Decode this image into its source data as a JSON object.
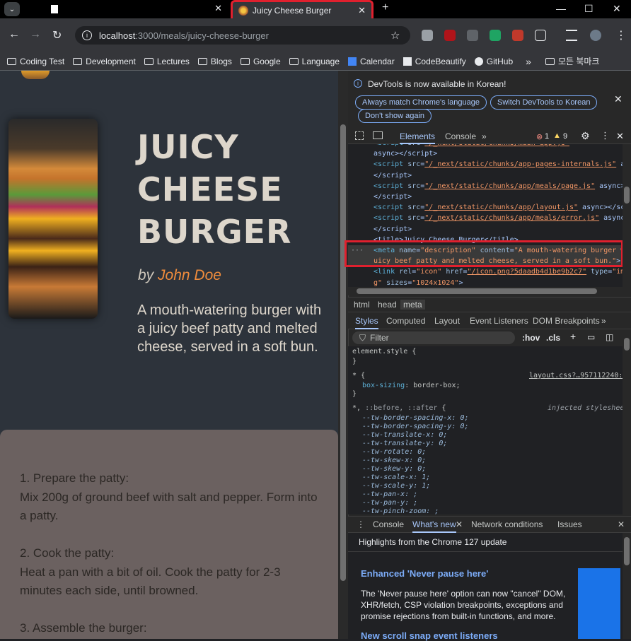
{
  "tabs": [
    {
      "label": "",
      "active": false
    },
    {
      "label": "Juicy Cheese Burger",
      "active": true
    }
  ],
  "address": {
    "host": "localhost",
    "path": ":3000/meals/juicy-cheese-burger"
  },
  "bookmarks": [
    {
      "label": "Coding Test",
      "icon": "folder-icon"
    },
    {
      "label": "Development",
      "icon": "folder-icon"
    },
    {
      "label": "Lectures",
      "icon": "folder-icon"
    },
    {
      "label": "Blogs",
      "icon": "folder-icon"
    },
    {
      "label": "Google",
      "icon": "folder-icon"
    },
    {
      "label": "Language",
      "icon": "folder-icon"
    },
    {
      "label": "Calendar",
      "icon": "calendar-icon"
    },
    {
      "label": "CodeBeautify",
      "icon": "codebeautify-icon"
    },
    {
      "label": "GitHub",
      "icon": "github-icon"
    }
  ],
  "bookmarks_overflow": "»",
  "bookmarks_all": "모든 북마크",
  "meal": {
    "title": "Juicy Cheese Burger",
    "by": "by",
    "author": "John Doe",
    "summary": "A mouth-watering burger with a juicy beef patty and melted cheese, served in a soft bun.",
    "instructions": [
      {
        "step": "1. Prepare the patty:",
        "text": "Mix 200g of ground beef with salt and pepper. Form into a patty."
      },
      {
        "step": "2. Cook the patty:",
        "text": "Heat a pan with a bit of oil. Cook the patty for 2-3 minutes each side, until browned."
      },
      {
        "step": "3. Assemble the burger:",
        "text": ""
      }
    ]
  },
  "devtools": {
    "notice": "DevTools is now available in Korean!",
    "btn_match": "Always match Chrome's language",
    "btn_switch": "Switch DevTools to Korean",
    "btn_dont": "Don't show again",
    "tabs": [
      "Elements",
      "Console"
    ],
    "errors": "1",
    "warnings": "9",
    "crumbs": [
      "html",
      "head",
      "meta"
    ],
    "style_tabs": [
      "Styles",
      "Computed",
      "Layout",
      "Event Listeners",
      "DOM Breakpoints"
    ],
    "filter_placeholder": "Filter",
    "hov": ":hov",
    "cls": ".cls",
    "drawer_tabs": [
      "Console",
      "What's new",
      "Network conditions",
      "Issues"
    ],
    "whatsnew_title": "Highlights from the Chrome 127 update",
    "whatsnew_h1": "Enhanced 'Never pause here'",
    "whatsnew_p1": "The 'Never pause here' option can now \"cancel\" DOM, XHR/fetch, CSP violation breakpoints, exceptions and promise rejections from built-in functions, and more.",
    "whatsnew_h2": "New scroll snap event listeners"
  }
}
